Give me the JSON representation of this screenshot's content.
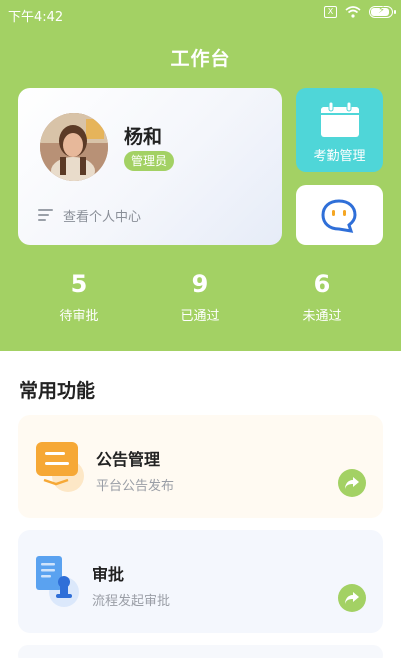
{
  "status_bar": {
    "time": "下午4:42",
    "box_icon_text": "X",
    "battery_level": 0.8
  },
  "header": {
    "title": "工作台"
  },
  "profile": {
    "name": "杨和",
    "role": "管理员",
    "view_profile": "查看个人中心"
  },
  "quick_actions": {
    "attendance_label": "考勤管理"
  },
  "stats": [
    {
      "value": "5",
      "label": "待审批"
    },
    {
      "value": "9",
      "label": "已通过"
    },
    {
      "value": "6",
      "label": "未通过"
    }
  ],
  "common": {
    "title": "常用功能",
    "items": [
      {
        "title": "公告管理",
        "desc": "平台公告发布",
        "icon": "notice-icon"
      },
      {
        "title": "审批",
        "desc": "流程发起审批",
        "icon": "approval-icon"
      }
    ]
  },
  "colors": {
    "accent": "#a3d164",
    "teal": "#4fd6d8",
    "orange": "#f6a836",
    "blue": "#3f8de8"
  }
}
